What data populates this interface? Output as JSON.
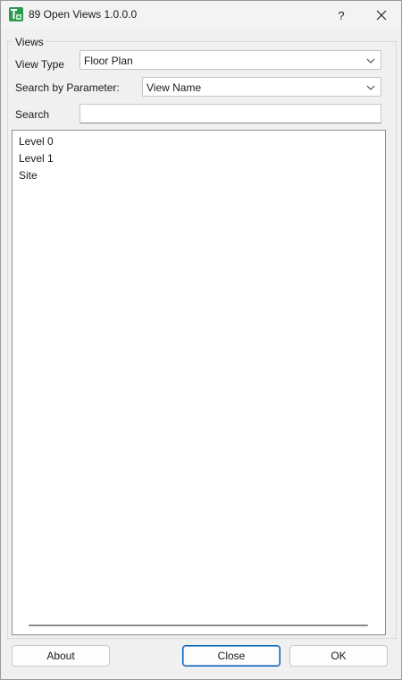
{
  "window": {
    "title": "89 Open Views 1.0.0.0",
    "help_label": "?"
  },
  "icons": {
    "app": "app-logo-icon",
    "close": "close-icon",
    "chevron": "chevron-down-icon"
  },
  "views_group": {
    "title": "Views",
    "view_type": {
      "label": "View Type",
      "selected": "Floor Plan"
    },
    "search_param": {
      "label": "Search by Parameter:",
      "selected": "View Name"
    },
    "search": {
      "label": "Search",
      "value": ""
    },
    "list": {
      "items": [
        "Level 0",
        "Level 1",
        "Site"
      ]
    }
  },
  "buttons": {
    "about": "About",
    "close": "Close",
    "ok": "OK"
  },
  "colors": {
    "accent": "#005fb8",
    "app_icon": "#2e9b4f"
  }
}
